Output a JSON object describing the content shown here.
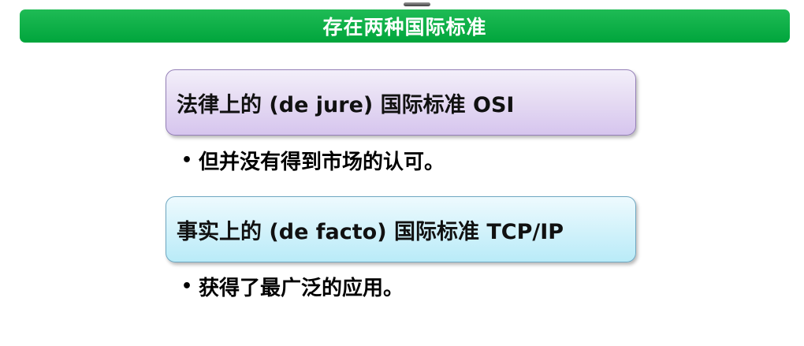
{
  "slide": {
    "title": "存在两种国际标准",
    "standards": [
      {
        "label": "法律上的 (de jure) 国际标准 OSI",
        "note_bullet": "•",
        "note": "但并没有得到市场的认可。"
      },
      {
        "label": "事实上的 (de facto) 国际标准 TCP/IP",
        "note_bullet": "•",
        "note": "获得了最广泛的应用。"
      }
    ]
  },
  "colors": {
    "title_bar": "#00a53c",
    "title_text": "#ffffff",
    "osi_box": "#e6dcf3",
    "osi_border": "#9580b8",
    "tcp_box": "#d6f3fb",
    "tcp_border": "#6fa8c2"
  }
}
